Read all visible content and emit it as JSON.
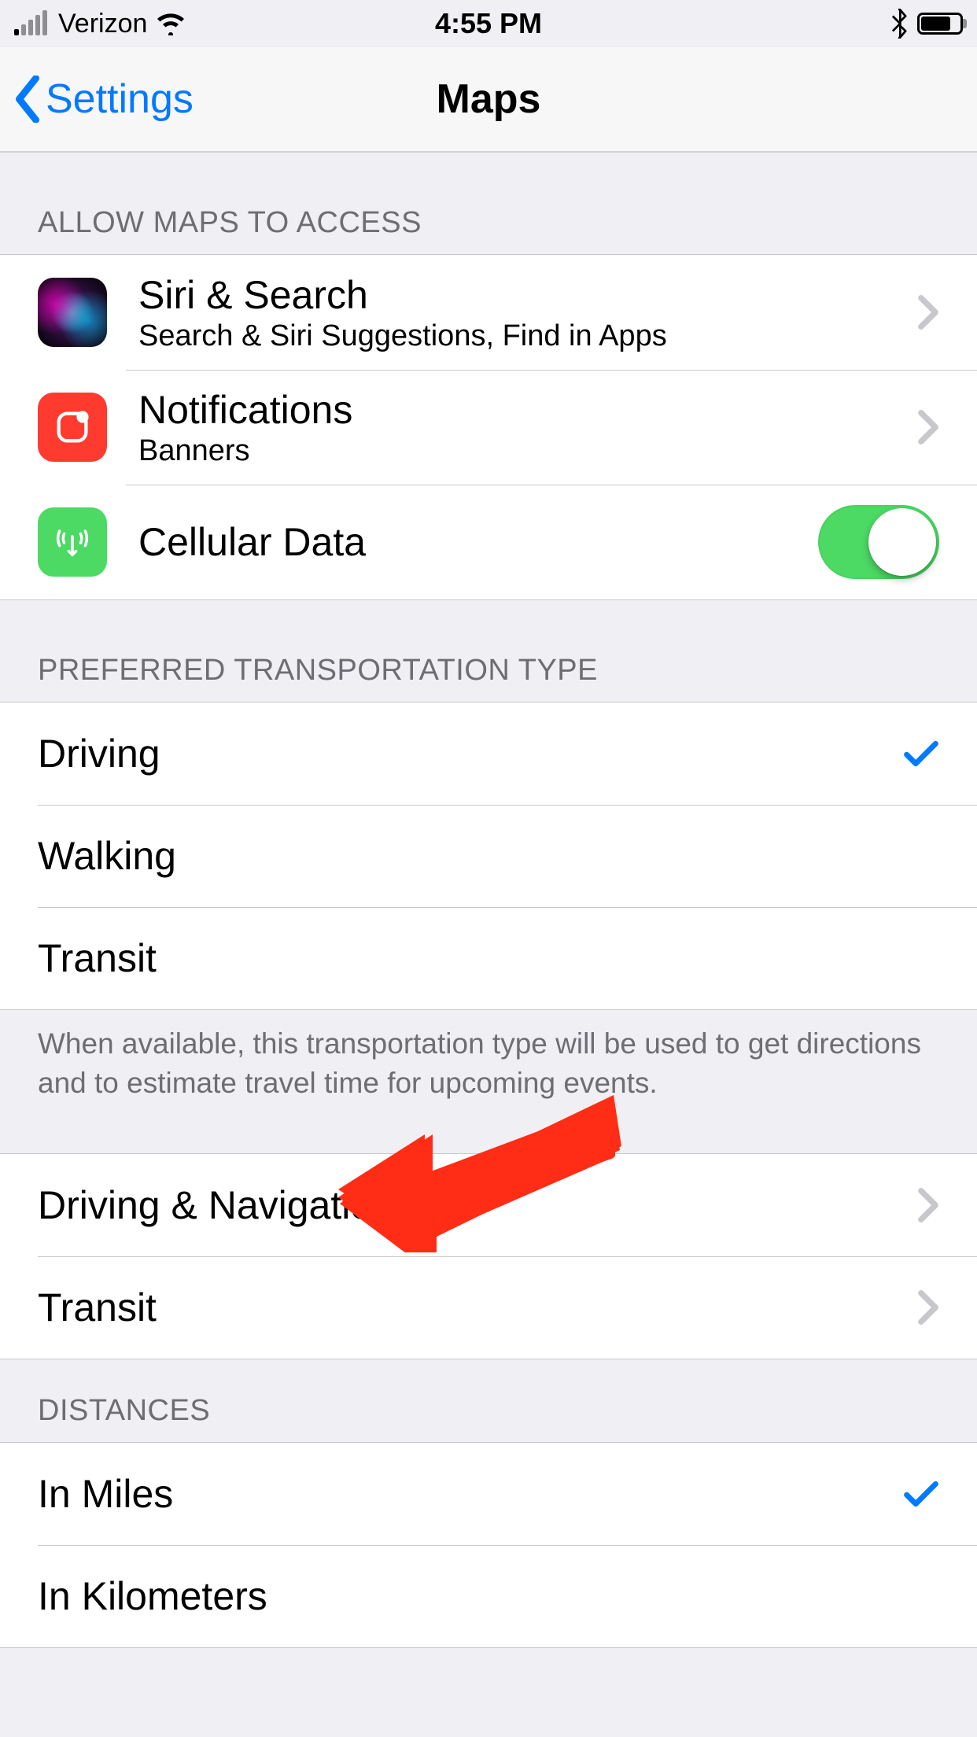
{
  "status": {
    "carrier": "Verizon",
    "time": "4:55 PM"
  },
  "nav": {
    "back_label": "Settings",
    "title": "Maps"
  },
  "sections": {
    "access": {
      "header": "ALLOW MAPS TO ACCESS",
      "siri_title": "Siri & Search",
      "siri_sub": "Search & Siri Suggestions, Find in Apps",
      "notif_title": "Notifications",
      "notif_sub": "Banners",
      "cell_title": "Cellular Data",
      "cell_on": true
    },
    "transport": {
      "header": "PREFERRED TRANSPORTATION TYPE",
      "driving": "Driving",
      "walking": "Walking",
      "transit": "Transit",
      "footer": "When available, this transportation type will be used to get directions and to estimate travel time for upcoming events."
    },
    "nav_section": {
      "driving_nav": "Driving & Navigation",
      "transit": "Transit"
    },
    "distances": {
      "header": "DISTANCES",
      "miles": "In Miles",
      "km": "In Kilometers"
    }
  }
}
